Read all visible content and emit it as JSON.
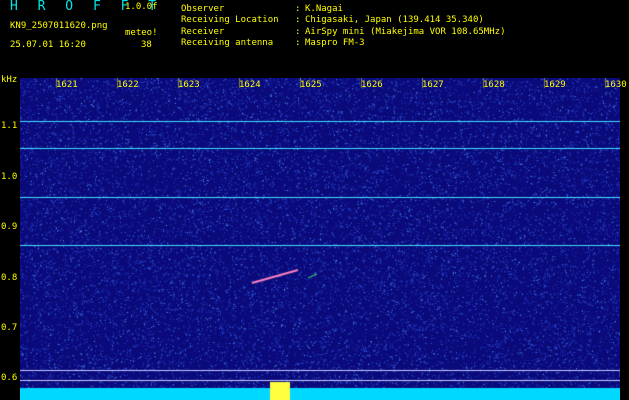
{
  "header": {
    "app_name": "H R O F F T",
    "version": "1.0.0f",
    "filename": "KN9_2507011620.png",
    "mode": "meteo!",
    "datetime": "25.07.01 16:20",
    "count": "38"
  },
  "info": {
    "labels": [
      "Observer",
      "Receiving Location",
      "Receiver",
      "Receiving antenna"
    ],
    "values": [
      "K.Nagai",
      "Chigasaki, Japan (139.414 35.340)",
      "AirSpy mini (Miakejima VOR 108.65MHz)",
      "Maspro FM-3"
    ]
  },
  "axes": {
    "y_unit": "kHz",
    "y_ticks": [
      "1.1",
      "1.0",
      "0.9",
      "0.8",
      "0.7",
      "0.6"
    ],
    "x_ticks": [
      "1621",
      "1622",
      "1623",
      "1624",
      "1625",
      "1626",
      "1627",
      "1628",
      "1629",
      "1630"
    ]
  },
  "colors": {
    "background": "#0a0a7a",
    "label_yellow": "#ffff00",
    "title_cyan": "#00e5e5",
    "trace_cyan": "#40e0ff",
    "meteor_trail": "#ff80c0"
  }
}
